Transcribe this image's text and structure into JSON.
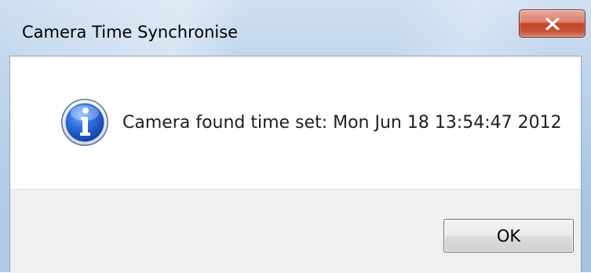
{
  "window": {
    "title": "Camera Time Synchronise",
    "close_glyph": "X"
  },
  "dialog": {
    "icon": "info-icon",
    "message": "Camera found time set: Mon Jun 18 13:54:47 2012",
    "ok_label": "OK"
  },
  "colors": {
    "close_button": "#c2462b",
    "info_icon_blue": "#1f4fb8",
    "button_area_bg": "#f0f0f0"
  }
}
